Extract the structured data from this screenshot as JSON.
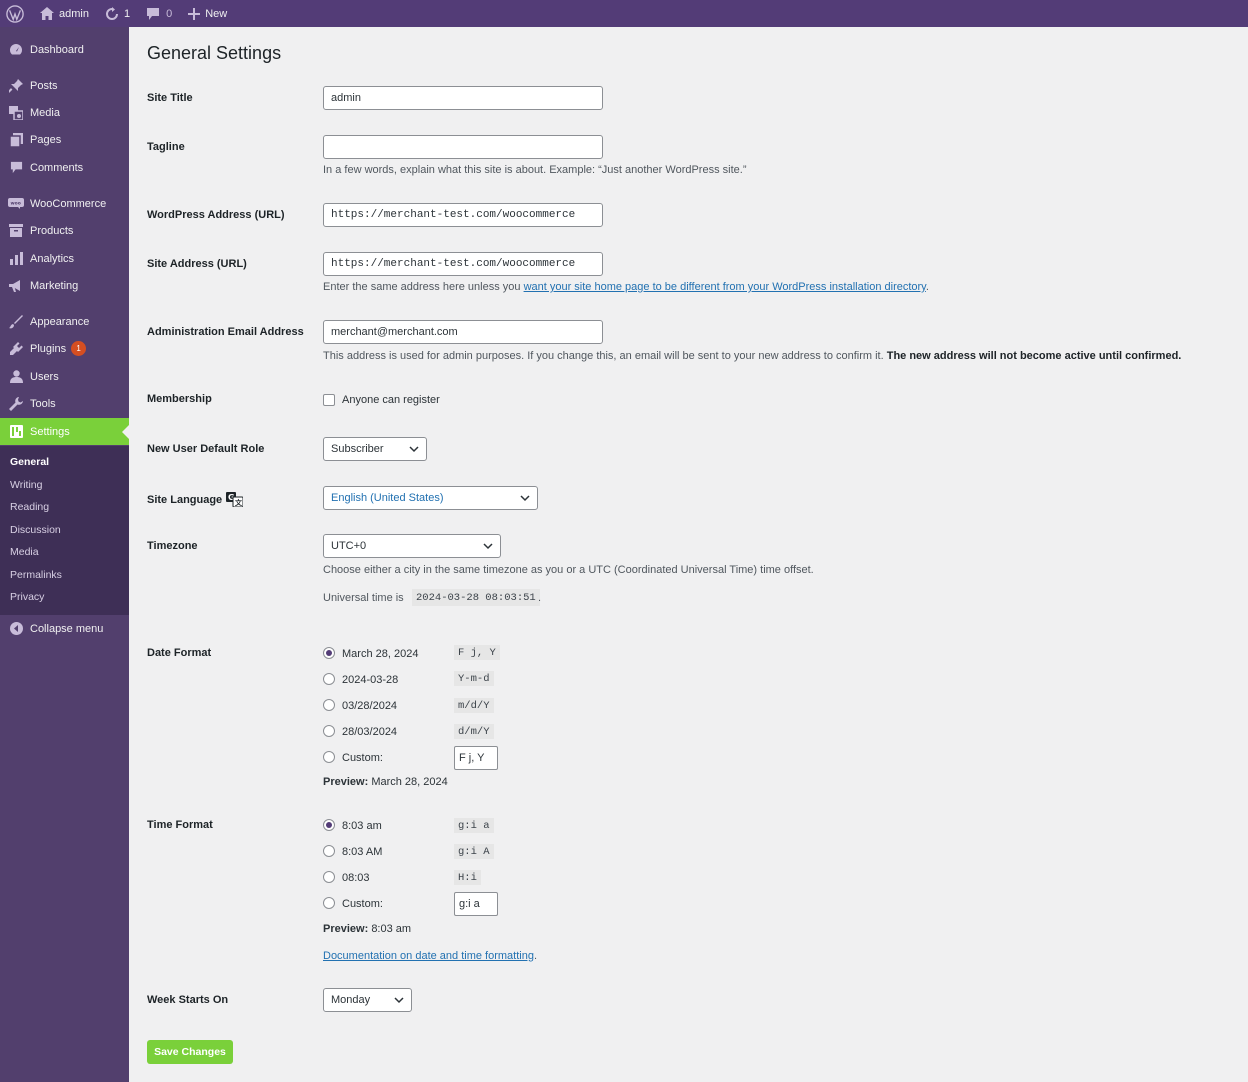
{
  "adminbar": {
    "site_name": "admin",
    "updates_count": "1",
    "comments_count": "0",
    "new_label": "New"
  },
  "sidebar": {
    "items": [
      {
        "label": "Dashboard",
        "icon": "dashboard-icon"
      },
      {
        "label": "Posts",
        "icon": "pin-icon"
      },
      {
        "label": "Media",
        "icon": "media-icon"
      },
      {
        "label": "Pages",
        "icon": "pages-icon"
      },
      {
        "label": "Comments",
        "icon": "comment-icon"
      },
      {
        "label": "WooCommerce",
        "icon": "woocommerce-icon"
      },
      {
        "label": "Products",
        "icon": "archive-icon"
      },
      {
        "label": "Analytics",
        "icon": "bar-chart-icon"
      },
      {
        "label": "Marketing",
        "icon": "megaphone-icon"
      },
      {
        "label": "Appearance",
        "icon": "paintbrush-icon"
      },
      {
        "label": "Plugins",
        "icon": "plug-icon",
        "badge": "1"
      },
      {
        "label": "Users",
        "icon": "user-icon"
      },
      {
        "label": "Tools",
        "icon": "wrench-icon"
      },
      {
        "label": "Settings",
        "icon": "settings-icon",
        "current": true
      }
    ],
    "submenu": [
      "General",
      "Writing",
      "Reading",
      "Discussion",
      "Media",
      "Permalinks",
      "Privacy"
    ],
    "collapse_label": "Collapse menu"
  },
  "page": {
    "title": "General Settings",
    "site_title": {
      "label": "Site Title",
      "value": "admin"
    },
    "tagline": {
      "label": "Tagline",
      "value": "",
      "description": "In a few words, explain what this site is about. Example: “Just another WordPress site.”"
    },
    "wp_address": {
      "label": "WordPress Address (URL)",
      "value": "https://merchant-test.com/woocommerce"
    },
    "site_address": {
      "label": "Site Address (URL)",
      "value": "https://merchant-test.com/woocommerce",
      "description_prefix": "Enter the same address here unless you ",
      "description_link": "want your site home page to be different from your WordPress installation directory",
      "description_suffix": "."
    },
    "admin_email": {
      "label": "Administration Email Address",
      "value": "merchant@merchant.com",
      "description_prefix": "This address is used for admin purposes. If you change this, an email will be sent to your new address to confirm it. ",
      "description_bold": "The new address will not become active until confirmed."
    },
    "membership": {
      "label": "Membership",
      "checkbox_label": "Anyone can register",
      "checked": false
    },
    "default_role": {
      "label": "New User Default Role",
      "value": "Subscriber"
    },
    "site_language": {
      "label": "Site Language",
      "value": "English (United States)"
    },
    "timezone": {
      "label": "Timezone",
      "value": "UTC+0",
      "description": "Choose either a city in the same timezone as you or a UTC (Coordinated Universal Time) time offset.",
      "universal_prefix": "Universal time is",
      "universal_time": "2024-03-28 08:03:51",
      "universal_suffix": "."
    },
    "date_format": {
      "label": "Date Format",
      "options": [
        {
          "label": "March 28, 2024",
          "code": "F j, Y",
          "checked": true
        },
        {
          "label": "2024-03-28",
          "code": "Y-m-d",
          "checked": false
        },
        {
          "label": "03/28/2024",
          "code": "m/d/Y",
          "checked": false
        },
        {
          "label": "28/03/2024",
          "code": "d/m/Y",
          "checked": false
        }
      ],
      "custom_label": "Custom:",
      "custom_value": "F j, Y",
      "preview_label": "Preview:",
      "preview_value": "March 28, 2024"
    },
    "time_format": {
      "label": "Time Format",
      "options": [
        {
          "label": "8:03 am",
          "code": "g:i a",
          "checked": true
        },
        {
          "label": "8:03 AM",
          "code": "g:i A",
          "checked": false
        },
        {
          "label": "08:03",
          "code": "H:i",
          "checked": false
        }
      ],
      "custom_label": "Custom:",
      "custom_value": "g:i a",
      "preview_label": "Preview:",
      "preview_value": "8:03 am",
      "doc_link": "Documentation on date and time formatting",
      "doc_suffix": "."
    },
    "week_starts": {
      "label": "Week Starts On",
      "value": "Monday"
    },
    "save_label": "Save Changes"
  },
  "colors": {
    "admin_bar": "#533c77",
    "sidebar": "#523f6d",
    "accent": "#7ad03a",
    "link": "#2271b1"
  }
}
